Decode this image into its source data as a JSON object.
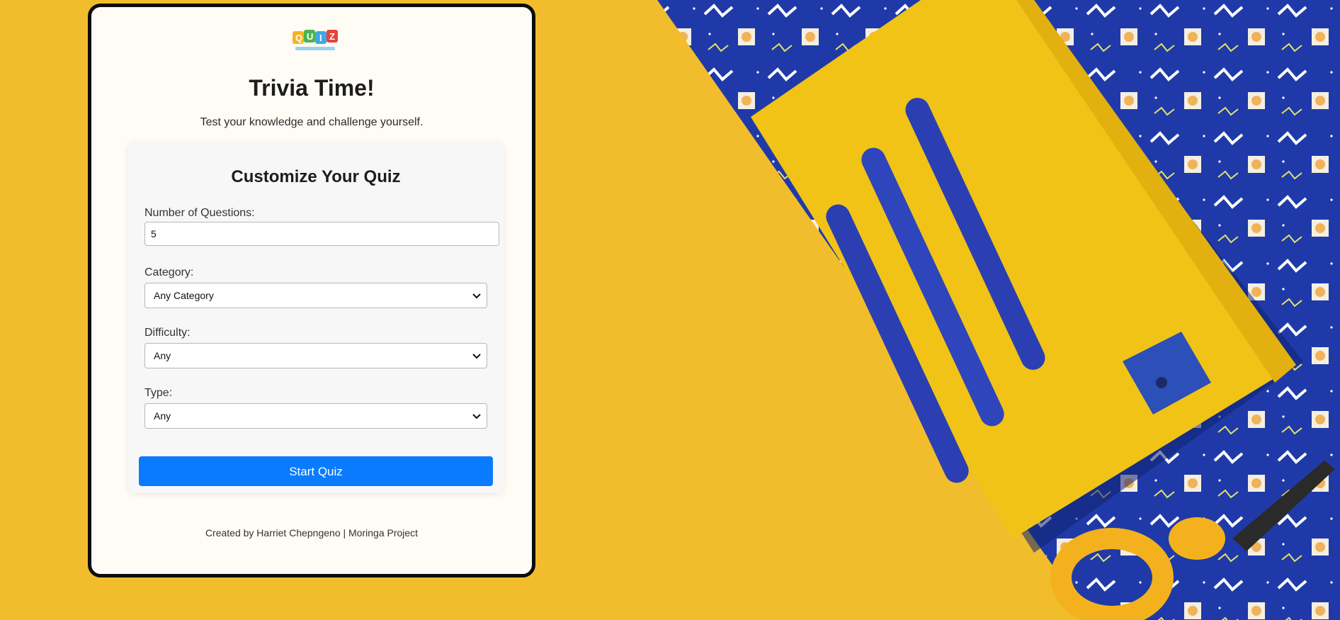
{
  "app": {
    "title": "Trivia Time!",
    "subtitle": "Test your knowledge and challenge yourself.",
    "logo_text": "QUIZ"
  },
  "form": {
    "title": "Customize Your Quiz",
    "num_questions": {
      "label": "Number of Questions:",
      "value": "5"
    },
    "category": {
      "label": "Category:",
      "selected": "Any Category"
    },
    "difficulty": {
      "label": "Difficulty:",
      "selected": "Any"
    },
    "type": {
      "label": "Type:",
      "selected": "Any"
    },
    "start_button": "Start Quiz"
  },
  "footer": {
    "credit": "Created by Harriet Chepngeno | Moringa Project"
  },
  "colors": {
    "background": "#f2bd2c",
    "accent": "#0a7bff",
    "card": "#fffbf5"
  },
  "icons": [
    "quiz-logo-icon",
    "chevron-down-icon"
  ]
}
